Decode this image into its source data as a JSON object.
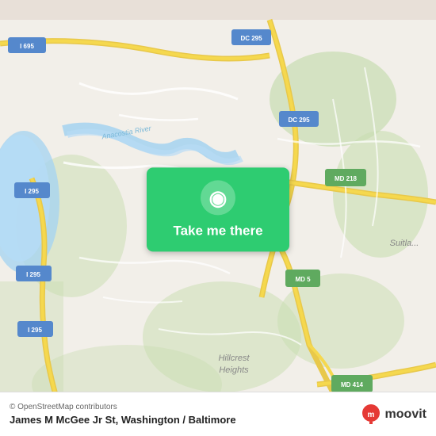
{
  "map": {
    "alt": "Map of Washington / Baltimore area",
    "attribution": "© OpenStreetMap contributors",
    "location_name": "James M McGee Jr St, Washington / Baltimore"
  },
  "button": {
    "label": "Take me there",
    "pin_icon": "📍"
  },
  "logo": {
    "name": "moovit",
    "text": "moovit"
  },
  "colors": {
    "green": "#2ecc71",
    "road_yellow": "#f5d020",
    "road_white": "#ffffff",
    "map_bg": "#f2efe9",
    "water": "#a8c8e8",
    "green_area": "#d4e8c2"
  }
}
